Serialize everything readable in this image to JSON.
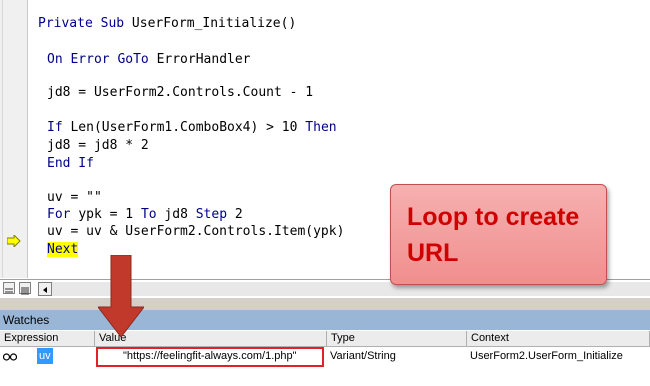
{
  "code": {
    "lines": [
      {
        "parts": [
          {
            "t": "Private Sub ",
            "c": "kw"
          },
          {
            "t": "UserForm_Initialize()",
            "c": ""
          }
        ]
      },
      {
        "parts": [
          {
            "t": "On Error GoTo ",
            "c": "kw"
          },
          {
            "t": "ErrorHandler",
            "c": ""
          }
        ]
      },
      {
        "parts": [
          {
            "t": "jd8 = UserForm2.Controls.Count - 1",
            "c": ""
          }
        ]
      },
      {
        "parts": [
          {
            "t": "If ",
            "c": "kw"
          },
          {
            "t": "Len(UserForm1.ComboBox4) > 10 ",
            "c": ""
          },
          {
            "t": "Then",
            "c": "kw"
          }
        ]
      },
      {
        "parts": [
          {
            "t": "jd8 = jd8 * 2",
            "c": ""
          }
        ]
      },
      {
        "parts": [
          {
            "t": "End If",
            "c": "kw"
          }
        ]
      },
      {
        "parts": [
          {
            "t": "uv = \"\"",
            "c": ""
          }
        ]
      },
      {
        "parts": [
          {
            "t": "For ",
            "c": "kw"
          },
          {
            "t": "ypk = 1 ",
            "c": ""
          },
          {
            "t": "To ",
            "c": "kw"
          },
          {
            "t": "jd8 ",
            "c": ""
          },
          {
            "t": "Step ",
            "c": "kw"
          },
          {
            "t": "2",
            "c": ""
          }
        ]
      },
      {
        "parts": [
          {
            "t": "uv = uv & UserForm2.Controls.Item(ypk)",
            "c": ""
          }
        ]
      },
      {
        "parts": [
          {
            "t": "Next",
            "c": "kw hl"
          }
        ]
      }
    ]
  },
  "callout": {
    "line1": "Loop to create",
    "line2": "URL"
  },
  "watches": {
    "title": "Watches",
    "headers": {
      "expression": "Expression",
      "value": "Value",
      "type": "Type",
      "context": "Context"
    },
    "row": {
      "expression": "uv",
      "value": "\"https://feelingfit-always.com/1.php\"",
      "type": "Variant/String",
      "context": "UserForm2.UserForm_Initialize"
    }
  },
  "colors": {
    "keyword": "#00008b",
    "exec_highlight": "#ffff00",
    "callout_text": "#d00000",
    "annotation_red": "#c0392b",
    "watches_title_bg": "#9ab6d6"
  },
  "icons": {
    "current_line": "exec-arrow-icon",
    "watch": "glasses-icon"
  }
}
